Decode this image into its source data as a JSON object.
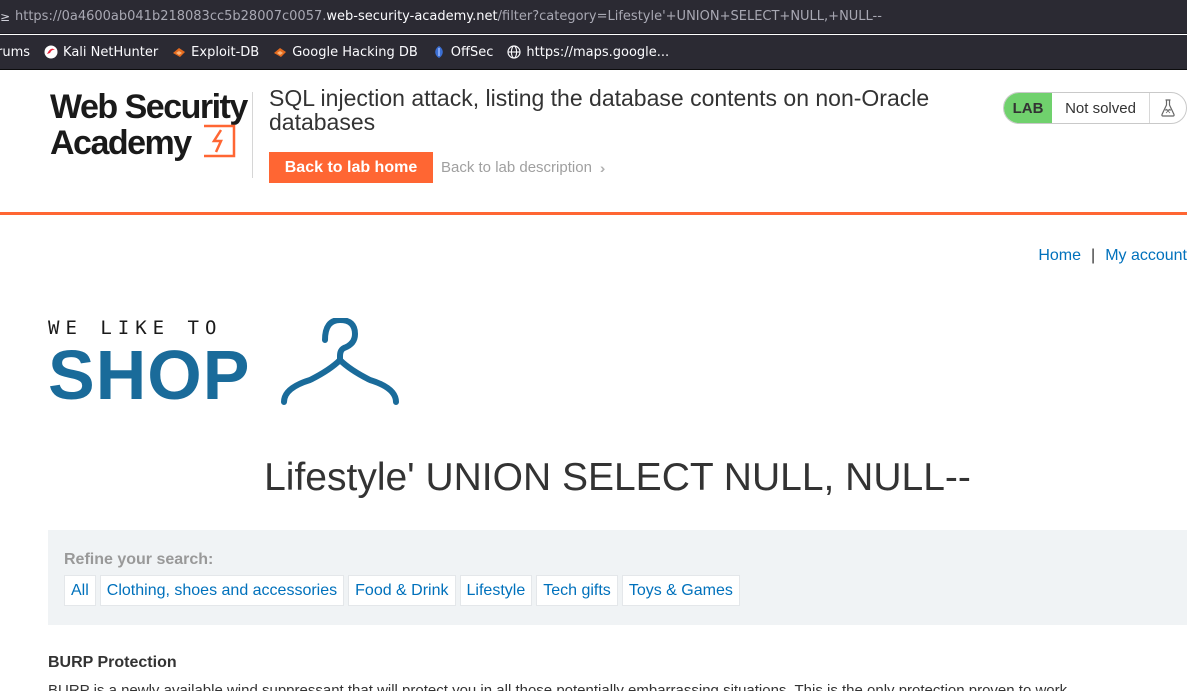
{
  "browser": {
    "url_prefix": "https://0a4600ab041b218083cc5b28007c0057.",
    "url_domain": "web-security-academy.net",
    "url_path": "/filter?category=Lifestyle'+UNION+SELECT+NULL,+NULL--",
    "bookmarks": [
      {
        "label": "rums",
        "icon": "forum-icon",
        "color": "#2b2a33"
      },
      {
        "label": "Kali NetHunter",
        "icon": "kali-icon",
        "color": "#e8243b"
      },
      {
        "label": "Exploit-DB",
        "icon": "exploit-db-icon",
        "color": "#e56b1f"
      },
      {
        "label": "Google Hacking DB",
        "icon": "ghdb-icon",
        "color": "#e56b1f"
      },
      {
        "label": "OffSec",
        "icon": "offsec-icon",
        "color": "#3b6fd4"
      },
      {
        "label": "https://maps.google...",
        "icon": "globe-icon",
        "color": "#2b2a33"
      }
    ]
  },
  "academy": {
    "logo_line1": "Web Security",
    "logo_line2": "Academy",
    "lab_title": "SQL injection attack, listing the database contents on non-Oracle databases",
    "back_home_label": "Back to lab home",
    "back_desc_label": "Back to lab description",
    "lab_tag": "LAB",
    "lab_status": "Not solved",
    "accent_color": "#ff6633",
    "status_color": "#70d16d"
  },
  "shop": {
    "nav_home": "Home",
    "nav_sep": "|",
    "nav_account": "My account",
    "logo_tagline": "WE LIKE TO",
    "logo_word": "SHOP",
    "heading": "Lifestyle' UNION SELECT NULL, NULL--",
    "refine_label": "Refine your search:",
    "filters": [
      "All",
      "Clothing, shoes and accessories",
      "Food & Drink",
      "Lifestyle",
      "Tech gifts",
      "Toys & Games"
    ],
    "product_title": "BURP Protection",
    "product_desc": "BURP is a newly available wind suppressant that will protect you in all those potentially embarrassing situations. This is the only protection proven to work"
  }
}
